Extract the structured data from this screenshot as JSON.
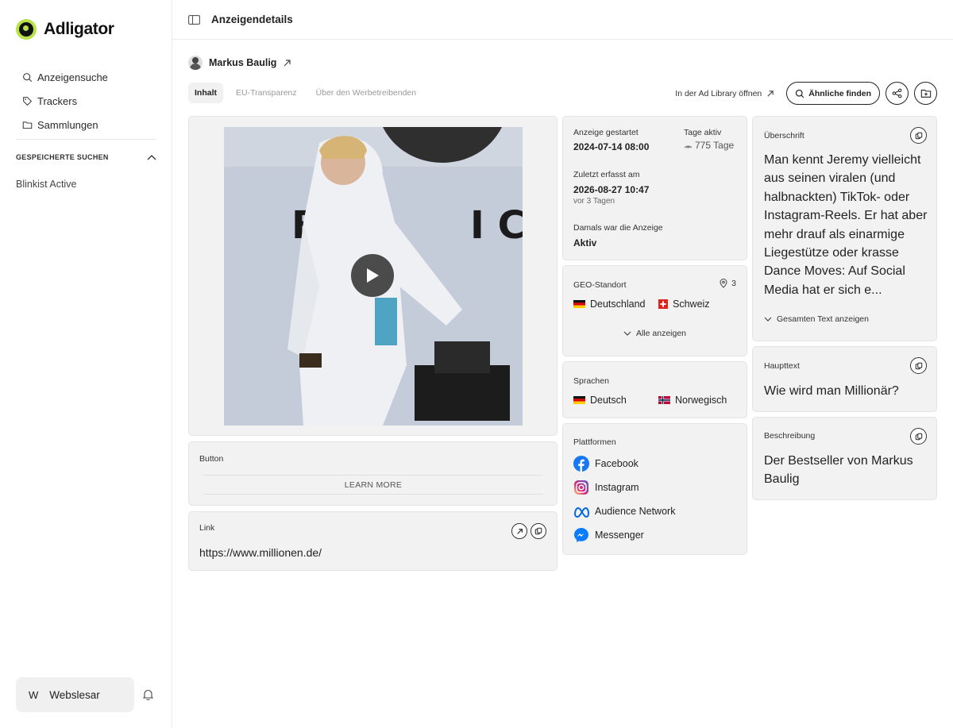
{
  "app": {
    "name": "Adligator"
  },
  "nav": {
    "search": "Anzeigensuche",
    "trackers": "Trackers",
    "collections": "Sammlungen"
  },
  "saved": {
    "title": "GESPEICHERTE SUCHEN",
    "items": [
      "Blinkist Active"
    ]
  },
  "user": {
    "initial": "W",
    "name": "Webslesar"
  },
  "page": {
    "title": "Anzeigendetails"
  },
  "advertiser": {
    "name": "Markus Baulig"
  },
  "tabs": [
    "Inhalt",
    "EU-Transparenz",
    "Über den Werbetreibenden"
  ],
  "actions": {
    "ad_library": "In der Ad Library öffnen",
    "similar": "Ähnliche finden"
  },
  "button_card": {
    "label": "Button",
    "cta": "LEARN MORE"
  },
  "link_card": {
    "label": "Link",
    "url": "https://www.millionen.de/"
  },
  "meta": {
    "started_label": "Anzeige gestartet",
    "started_value": "2024-07-14 08:00",
    "active_label": "Tage aktiv",
    "active_value": "775 Tage",
    "last_label": "Zuletzt erfasst am",
    "last_value": "2026-08-27 10:47",
    "last_ago": "vor 3 Tagen",
    "status_label": "Damals war die Anzeige",
    "status_value": "Aktiv"
  },
  "geo": {
    "label": "GEO-Standort",
    "count": "3",
    "countries": [
      "Deutschland",
      "Schweiz"
    ],
    "show_all": "Alle anzeigen"
  },
  "languages": {
    "label": "Sprachen",
    "items": [
      "Deutsch",
      "Norwegisch"
    ]
  },
  "platforms": {
    "label": "Plattformen",
    "items": [
      "Facebook",
      "Instagram",
      "Audience Network",
      "Messenger"
    ]
  },
  "headline": {
    "label": "Überschrift",
    "text": "Man kennt Jeremy vielleicht aus seinen viralen (und halbnackten) TikTok- oder Instagram-Reels. Er hat aber mehr drauf als einarmige Liegestütze oder krasse Dance Moves: Auf Social Media hat er sich e...",
    "show_more": "Gesamten Text anzeigen"
  },
  "main_text": {
    "label": "Haupttext",
    "text": "Wie wird man Millionär?"
  },
  "description": {
    "label": "Beschreibung",
    "text": "Der Bestseller von Markus Baulig"
  },
  "colors": {
    "brand": "#b9e14a",
    "facebook": "#1877f2",
    "messenger": "#0a7cff",
    "meta": "#0668e1"
  }
}
